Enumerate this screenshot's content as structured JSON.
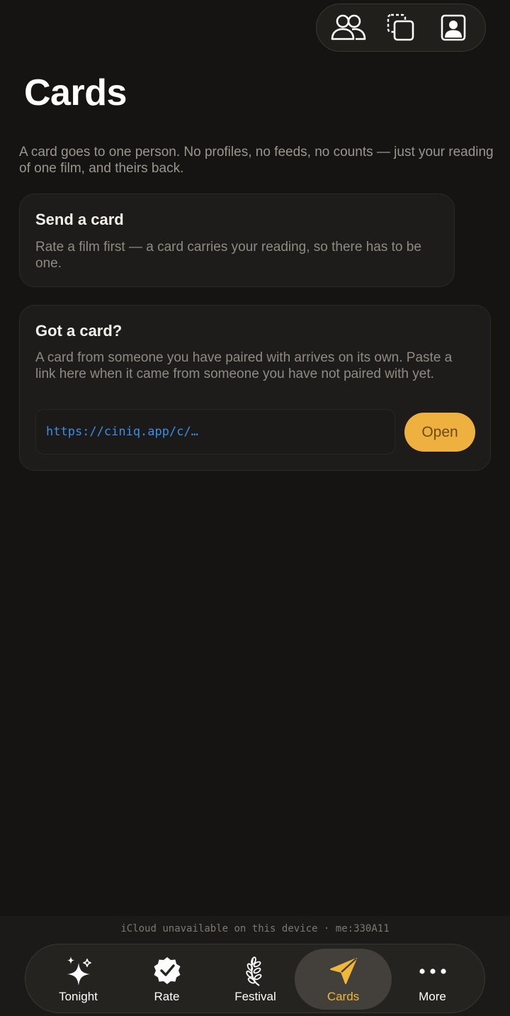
{
  "colors": {
    "background": "#151412",
    "accent": "#eeb13f",
    "link": "#3a8ee6",
    "muted_text": "#9b968d"
  },
  "top_actions": [
    {
      "icon": "people-icon"
    },
    {
      "icon": "copy-cards-icon"
    },
    {
      "icon": "profile-icon"
    }
  ],
  "page": {
    "title": "Cards",
    "intro": "A card goes to one person. No profiles, no feeds, no counts — just your reading of one film, and theirs back."
  },
  "send_card": {
    "title": "Send a card",
    "body": "Rate a film first — a card carries your reading, so there has to be one."
  },
  "got_card": {
    "title": "Got a card?",
    "body": "A card from someone you have paired with arrives on its own. Paste a link here when it came from someone you have not paired with yet.",
    "link_placeholder": "https://ciniq.app/c/…",
    "link_value": "",
    "open_label": "Open"
  },
  "status": {
    "text": "iCloud unavailable on this device · me:330A11"
  },
  "tabs": [
    {
      "label": "Tonight",
      "icon": "sparkles-icon",
      "active": false
    },
    {
      "label": "Rate",
      "icon": "check-badge-icon",
      "active": false
    },
    {
      "label": "Festival",
      "icon": "laurel-icon",
      "active": false
    },
    {
      "label": "Cards",
      "icon": "paper-plane-icon",
      "active": true
    },
    {
      "label": "More",
      "icon": "more-dots-icon",
      "active": false
    }
  ]
}
